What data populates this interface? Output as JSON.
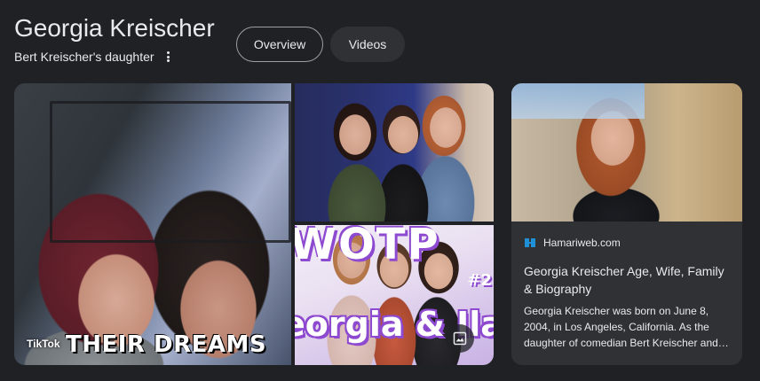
{
  "header": {
    "title": "Georgia Kreischer",
    "subtitle": "Bert Kreischer's daughter"
  },
  "tabs": [
    {
      "label": "Overview",
      "active": true
    },
    {
      "label": "Videos",
      "active": false
    }
  ],
  "gallery": {
    "main_image": {
      "source": "TikTok",
      "caption": "THEIR DREAMS"
    },
    "bottom_right_image": {
      "overlay_top": "WOTP",
      "overlay_episode": "#2",
      "overlay_names": "eorgia & Ila",
      "icon": "image-icon"
    }
  },
  "card": {
    "site": "Hamariweb.com",
    "site_icon": "hamariweb-logo-icon",
    "headline": "Georgia Kreischer Age, Wife, Family & Biography",
    "snippet": "Georgia Kreischer was born on June 8, 2004, in Los Angeles, California. As the daughter of comedian Bert Kreischer and…"
  },
  "colors": {
    "background": "#202124",
    "surface": "#303134",
    "text": "#e8eaed",
    "border": "#9aa0a6"
  }
}
